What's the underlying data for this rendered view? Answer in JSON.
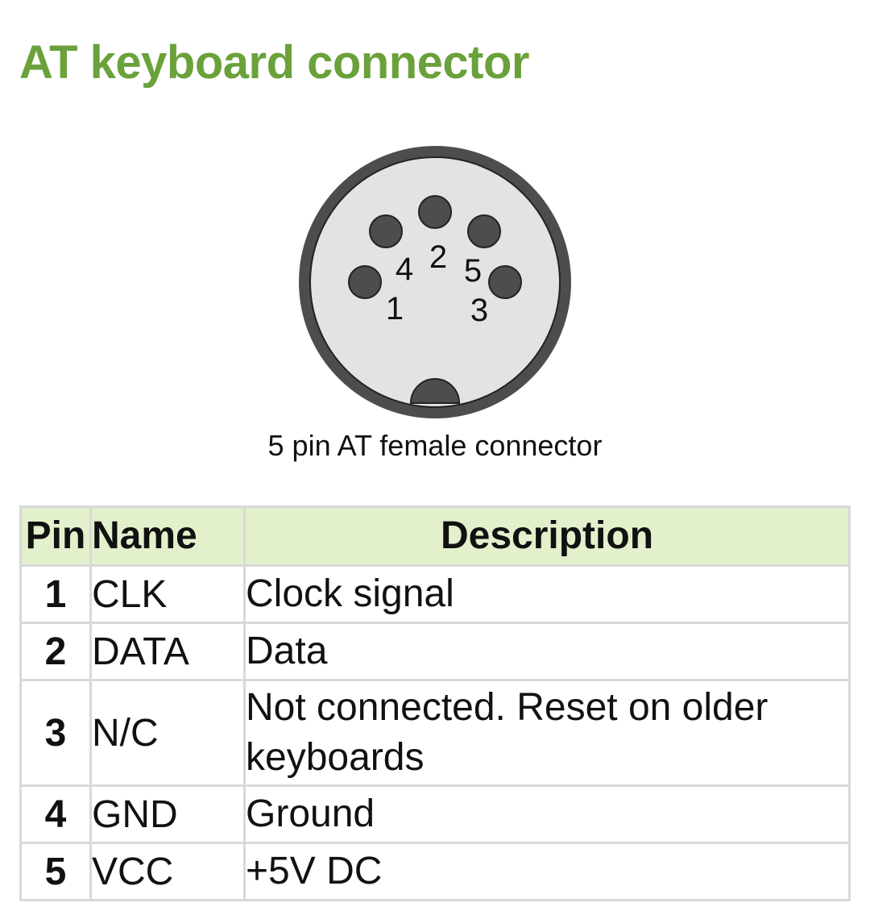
{
  "title": "AT keyboard connector",
  "diagram": {
    "caption": "5 pin AT female connector",
    "pin_labels": [
      "1",
      "2",
      "3",
      "4",
      "5"
    ],
    "colors": {
      "body_fill": "#e3e3e3",
      "outer_ring": "#4d4d4d",
      "pin_fill": "#4d4d4d"
    }
  },
  "table": {
    "headers": {
      "pin": "Pin",
      "name": "Name",
      "description": "Description"
    },
    "rows": [
      {
        "pin": "1",
        "name": "CLK",
        "description": "Clock signal"
      },
      {
        "pin": "2",
        "name": "DATA",
        "description": "Data"
      },
      {
        "pin": "3",
        "name": "N/C",
        "description": "Not connected. Reset on older keyboards"
      },
      {
        "pin": "4",
        "name": "GND",
        "description": "Ground"
      },
      {
        "pin": "5",
        "name": "VCC",
        "description": "+5V DC"
      }
    ],
    "colors": {
      "header_bg": "#e2f0cc",
      "border": "#d9d9d9"
    }
  },
  "colors": {
    "title": "#6aa13b"
  }
}
